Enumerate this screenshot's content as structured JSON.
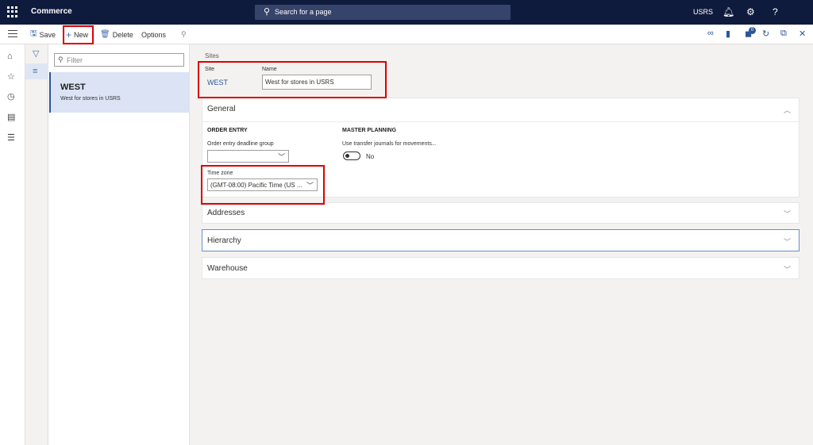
{
  "topbar": {
    "app_name": "Commerce",
    "search_placeholder": "Search for a page",
    "company": "USRS",
    "help_icon_text": "?"
  },
  "actionbar": {
    "save": "Save",
    "new": "New",
    "delete": "Delete",
    "options": "Options",
    "notification_count": "0"
  },
  "list": {
    "filter_placeholder": "Filter",
    "items": [
      {
        "title": "WEST",
        "subtitle": "West for stores in USRS"
      }
    ]
  },
  "header": {
    "breadcrumb": "Sites",
    "site_label": "Site",
    "site_value": "WEST",
    "name_label": "Name",
    "name_value": "West for stores in USRS"
  },
  "general": {
    "title": "General",
    "order_entry": {
      "heading": "ORDER ENTRY",
      "deadline_label": "Order entry deadline group",
      "deadline_value": "",
      "timezone_label": "Time zone",
      "timezone_value": "(GMT-08:00) Pacific Time (US ..."
    },
    "master_planning": {
      "heading": "MASTER PLANNING",
      "transfer_label": "Use transfer journals for movements...",
      "transfer_value": "No"
    }
  },
  "sections": {
    "addresses": "Addresses",
    "hierarchy": "Hierarchy",
    "warehouse": "Warehouse"
  },
  "colors": {
    "topbar": "#0f1b3d",
    "accent": "#2b579a",
    "highlight": "#dd0000"
  }
}
